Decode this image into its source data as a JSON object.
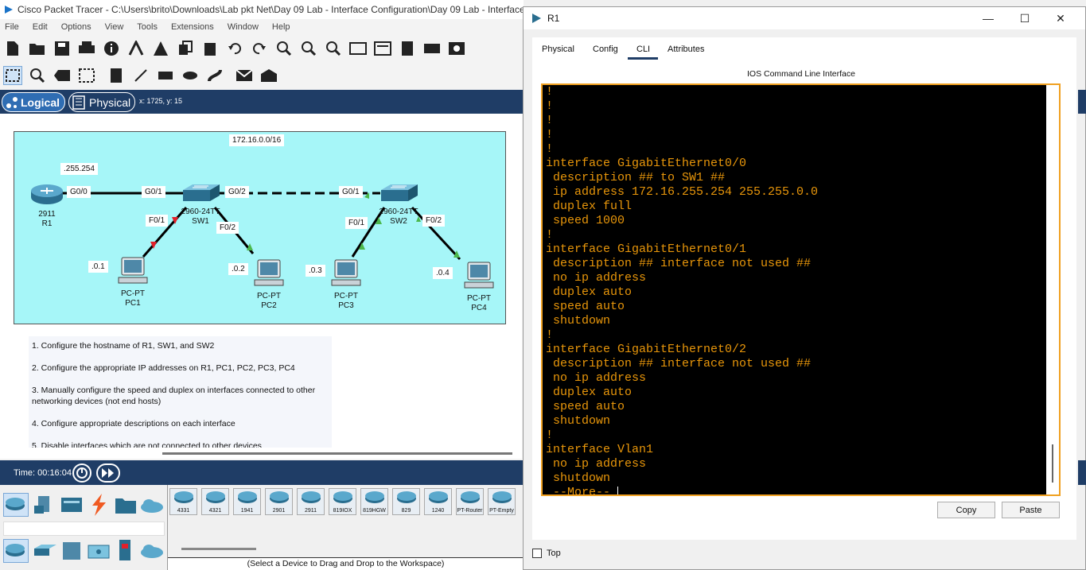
{
  "main_window": {
    "title": "Cisco Packet Tracer - C:\\Users\\brito\\Downloads\\Lab pkt Net\\Day 09 Lab - Interface Configuration\\Day 09 Lab - Interface",
    "menu": [
      "File",
      "Edit",
      "Options",
      "View",
      "Tools",
      "Extensions",
      "Window",
      "Help"
    ],
    "mode_logical": "Logical",
    "mode_physical": "Physical",
    "coords": "x: 1725, y: 15"
  },
  "topology": {
    "network_label": "172.16.0.0/16",
    "mask_label": ".255.254",
    "port_labels": {
      "r1_g00": "G0/0",
      "sw1_g01": "G0/1",
      "sw1_g02": "G0/2",
      "sw2_g01": "G0/1",
      "sw1_f01": "F0/1",
      "sw1_f02": "F0/2",
      "sw2_f01": "F0/1",
      "sw2_f02": "F0/2"
    },
    "ip_labels": {
      "pc1": ".0.1",
      "pc2": ".0.2",
      "pc3": ".0.3",
      "pc4": ".0.4"
    },
    "devices": {
      "r1": {
        "model": "2911",
        "name": "R1"
      },
      "sw1": {
        "model": "2960-24TT",
        "name": "SW1"
      },
      "sw2": {
        "model": "2960-24TT",
        "name": "SW2"
      },
      "pc1": {
        "model": "PC-PT",
        "name": "PC1"
      },
      "pc2": {
        "model": "PC-PT",
        "name": "PC2"
      },
      "pc3": {
        "model": "PC-PT",
        "name": "PC3"
      },
      "pc4": {
        "model": "PC-PT",
        "name": "PC4"
      }
    }
  },
  "notes": [
    "1. Configure the hostname of R1, SW1, and SW2",
    "2. Configure the appropriate IP addresses on R1, PC1, PC2, PC3, PC4",
    "3. Manually configure the speed and duplex on interfaces connected to other networking devices (not end hosts)",
    "4. Configure appropriate descriptions on each interface",
    "5. Disable interfaces which are not connected to other devices"
  ],
  "timebar": {
    "time": "Time: 00:16:04"
  },
  "device_list": [
    "4331",
    "4321",
    "1941",
    "2901",
    "2911",
    "819IOX",
    "819HGW",
    "829",
    "1240",
    "PT-Router",
    "PT-Empty"
  ],
  "status_hint": "(Select a Device to Drag and Drop to the Workspace)",
  "cli_window": {
    "title": "R1",
    "tabs": [
      "Physical",
      "Config",
      "CLI",
      "Attributes"
    ],
    "active_tab": "CLI",
    "heading": "IOS Command Line Interface",
    "lines": [
      "!",
      "!",
      "!",
      "!",
      "!",
      "interface GigabitEthernet0/0",
      " description ## to SW1 ##",
      " ip address 172.16.255.254 255.255.0.0",
      " duplex full",
      " speed 1000",
      "!",
      "interface GigabitEthernet0/1",
      " description ## interface not used ##",
      " no ip address",
      " duplex auto",
      " speed auto",
      " shutdown",
      "!",
      "interface GigabitEthernet0/2",
      " description ## interface not used ##",
      " no ip address",
      " duplex auto",
      " speed auto",
      " shutdown",
      "!",
      "interface Vlan1",
      " no ip address",
      " shutdown",
      " --More-- "
    ],
    "copy_label": "Copy",
    "paste_label": "Paste",
    "top_label": "Top"
  },
  "colors": {
    "cli_text": "#e8960a",
    "cli_border": "#f0a020",
    "mode_bar": "#1f3d66",
    "workspace_bg": "#a6f6f8"
  }
}
